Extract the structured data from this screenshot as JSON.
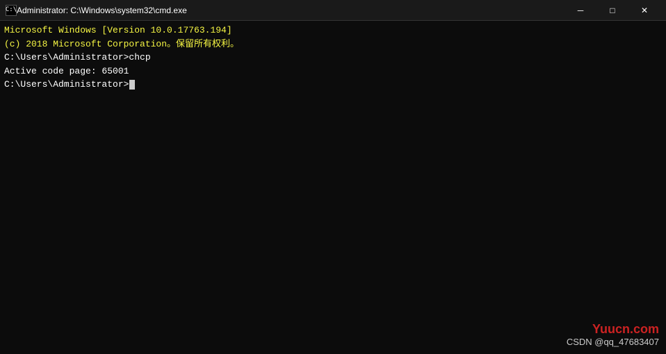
{
  "titlebar": {
    "title": "Administrator: C:\\Windows\\system32\\cmd.exe",
    "minimize_label": "─",
    "maximize_label": "□",
    "close_label": "✕"
  },
  "cmd": {
    "line1": "Microsoft Windows [Version 10.0.17763.194]",
    "line2": "(c) 2018 Microsoft Corporation。保留所有权利。",
    "line3": "",
    "line4": "C:\\Users\\Administrator>chcp",
    "line5": "Active code page: 65001",
    "line6": "",
    "line7": "C:\\Users\\Administrator>"
  },
  "watermark": {
    "yuucn": "Yuucn.com",
    "csdn": "CSDN @qq_47683407"
  }
}
